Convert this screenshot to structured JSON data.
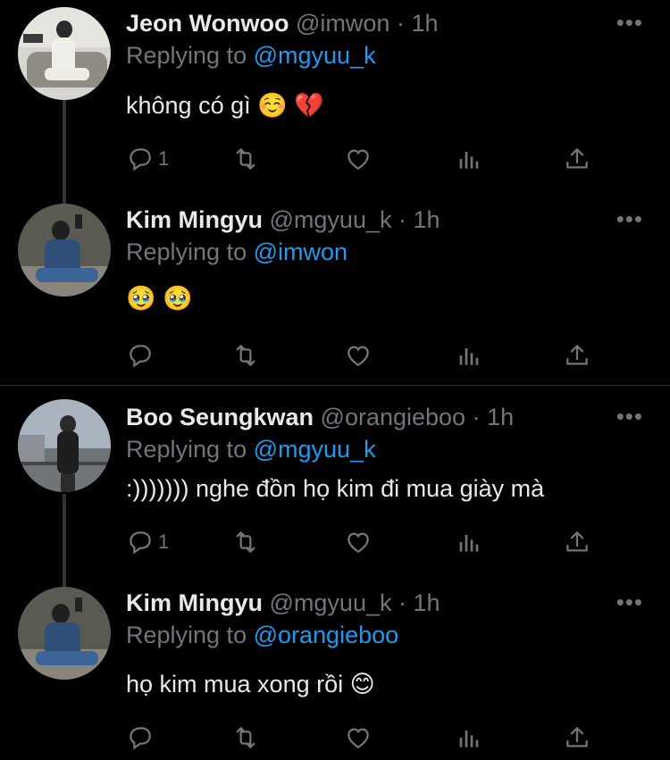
{
  "tweets": [
    {
      "name": "Jeon Wonwoo",
      "handle": "@imwon",
      "time": "· 1h",
      "replying_prefix": "Replying to",
      "replying_to": "@mgyuu_k",
      "text": "không có gì ☺️ 💔",
      "reply_count": "1",
      "more": "•••"
    },
    {
      "name": "Kim Mingyu",
      "handle": "@mgyuu_k",
      "time": "· 1h",
      "replying_prefix": "Replying to",
      "replying_to": "@imwon",
      "text": "🥹 🥹",
      "reply_count": "",
      "more": "•••"
    },
    {
      "name": "Boo Seungkwan",
      "handle": "@orangieboo",
      "time": "· 1h",
      "replying_prefix": "Replying to",
      "replying_to": "@mgyuu_k",
      "text": ":))))))) nghe đồn họ kim đi mua giày mà",
      "reply_count": "1",
      "more": "•••"
    },
    {
      "name": "Kim Mingyu",
      "handle": "@mgyuu_k",
      "time": "· 1h",
      "replying_prefix": "Replying to",
      "replying_to": "@orangieboo",
      "text": "họ kim mua xong rồi 😊",
      "reply_count": "",
      "more": "•••"
    }
  ],
  "colors": {
    "background": "#000000",
    "text": "#e7e9ea",
    "muted": "#71767b",
    "accent": "#1d9bf0",
    "divider": "#2f3336"
  }
}
